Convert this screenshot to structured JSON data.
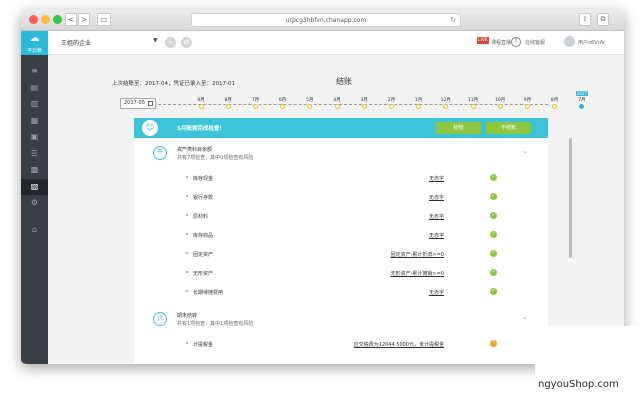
{
  "browser": {
    "url": "urpcg3hbfvn.chanapp.com",
    "nav_back": "<",
    "nav_forward": ">"
  },
  "sidebar": {
    "logo_text": "平云帐",
    "items": [
      {
        "icon": "voucher-icon",
        "glyph": "≡"
      },
      {
        "icon": "ledger-icon",
        "glyph": "▤"
      },
      {
        "icon": "report-icon",
        "glyph": "▥"
      },
      {
        "icon": "asset-icon",
        "glyph": "▦"
      },
      {
        "icon": "invoice-icon",
        "glyph": "▣"
      },
      {
        "icon": "payroll-icon",
        "glyph": "☰"
      },
      {
        "icon": "stock-icon",
        "glyph": "▩"
      },
      {
        "icon": "closing-icon",
        "glyph": "▧"
      },
      {
        "icon": "settings-icon",
        "glyph": "⚙"
      },
      {
        "icon": "gift-icon",
        "glyph": "⌂"
      }
    ]
  },
  "topbar": {
    "company": "王姐的企业",
    "tools": [
      {
        "label": "课程直播",
        "badge": "LIVE"
      },
      {
        "label": "在线客服"
      },
      {
        "label": "用户o6VrAr"
      }
    ]
  },
  "main": {
    "info": "上次结账至：2017-04，凭证已录入至：2017-01",
    "title": "结账",
    "month_select": "2017-05",
    "timeline": {
      "months": [
        "9月",
        "8月",
        "7月",
        "6月",
        "5月",
        "4月",
        "3月",
        "2月",
        "1月",
        "12月",
        "11月",
        "10月",
        "9月",
        "8月",
        "7月"
      ],
      "states": [
        "done",
        "done",
        "done",
        "done",
        "done",
        "done",
        "done",
        "done",
        "done",
        "done",
        "done",
        "done",
        "done",
        "done",
        "current"
      ],
      "current_flag": "2017"
    },
    "banner_text": "5月账套完成检查！",
    "btn_close": "结账",
    "btn_unclose": "不结账",
    "sections": [
      {
        "icon": "平",
        "title": "资产类科目余额",
        "subtitle": "共有7项检查，其中0项检查有风险",
        "rows": [
          {
            "label": "库存现金",
            "value": "无赤字",
            "status": "ok"
          },
          {
            "label": "银行存款",
            "value": "无赤字",
            "status": "ok"
          },
          {
            "label": "原材料",
            "value": "无赤字",
            "status": "ok"
          },
          {
            "label": "库存商品",
            "value": "无赤字",
            "status": "ok"
          },
          {
            "label": "固定资产",
            "value": "固定资产-累计折旧>=0",
            "status": "ok"
          },
          {
            "label": "无形资产",
            "value": "无形资产-累计摊销>=0",
            "status": "ok"
          },
          {
            "label": "长期待摊费用",
            "value": "无赤字",
            "status": "ok"
          }
        ]
      },
      {
        "icon": "计",
        "title": "期末结转",
        "subtitle": "共有1项检查，其中1项检查有风险",
        "rows": [
          {
            "label": "计提税金",
            "value": "应交税费为12044.5000元，未计提税金",
            "status": "warn"
          }
        ]
      }
    ]
  },
  "watermark": "ngyouShop.com",
  "colors": {
    "accent": "#3ec4d9",
    "ok": "#8dc63f",
    "warn": "#f0a31b",
    "sidebar": "#3a3f46"
  }
}
